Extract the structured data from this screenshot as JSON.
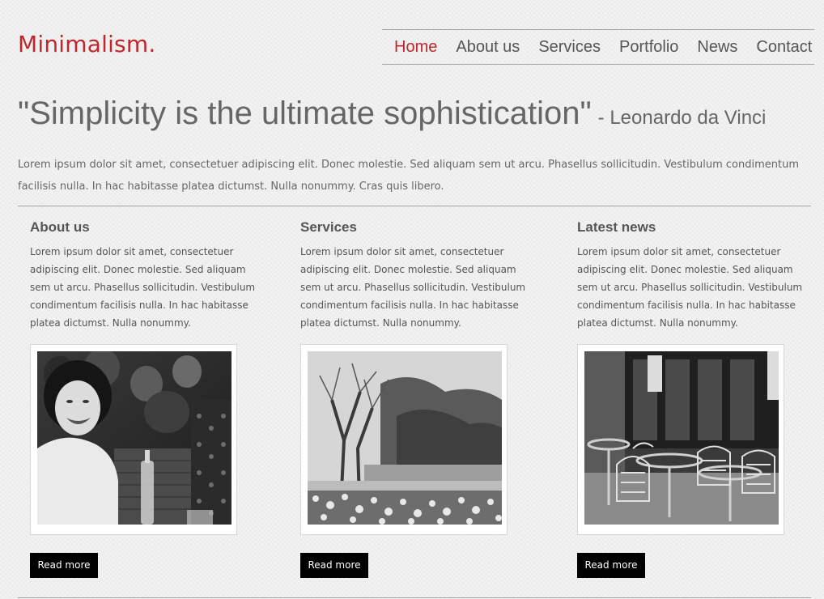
{
  "header": {
    "logo": "Minimalism.",
    "nav": [
      {
        "label": "Home",
        "active": true
      },
      {
        "label": "About us",
        "active": false
      },
      {
        "label": "Services",
        "active": false
      },
      {
        "label": "Portfolio",
        "active": false
      },
      {
        "label": "News",
        "active": false
      },
      {
        "label": "Contact",
        "active": false
      }
    ]
  },
  "hero": {
    "quote": "\"Simplicity is the ultimate sophistication\"",
    "author": "- Leonardo da Vinci",
    "intro": "Lorem ipsum dolor sit amet, consectetuer adipiscing elit. Donec molestie. Sed aliquam sem ut arcu. Phasellus sollicitudin. Vestibulum condimentum facilisis nulla. In hac habitasse platea dictumst. Nulla nonummy. Cras quis libero."
  },
  "columns": [
    {
      "title": "About us",
      "text": "Lorem ipsum dolor sit amet, consectetuer adipiscing elit. Donec molestie. Sed aliquam sem ut arcu. Phasellus sollicitudin. Vestibulum condimentum facilisis nulla. In hac habitasse platea dictumst. Nulla nonummy.",
      "image": "black-and-white photo of a laughing woman in a crowd",
      "button": "Read more"
    },
    {
      "title": "Services",
      "text": "Lorem ipsum dolor sit amet, consectetuer adipiscing elit. Donec molestie. Sed aliquam sem ut arcu. Phasellus sollicitudin. Vestibulum condimentum facilisis nulla. In hac habitasse platea dictumst. Nulla nonummy.",
      "image": "black-and-white photo of a park with trees, a pond and tulips",
      "button": "Read more"
    },
    {
      "title": "Latest news",
      "text": "Lorem ipsum dolor sit amet, consectetuer adipiscing elit. Donec molestie. Sed aliquam sem ut arcu. Phasellus sollicitudin. Vestibulum condimentum facilisis nulla. In hac habitasse platea dictumst. Nulla nonummy.",
      "image": "black-and-white photo of a cafe terrace with bistro chairs",
      "button": "Read more"
    }
  ],
  "colors": {
    "accent": "#c0272d",
    "text": "#555555",
    "button_bg": "#000000",
    "background": "#efefef"
  }
}
